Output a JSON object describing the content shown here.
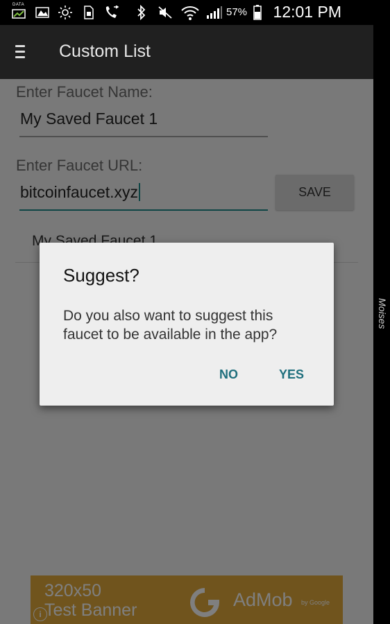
{
  "status_bar": {
    "data_label": "DATA",
    "battery_percent": "57%",
    "time": "12:01 PM"
  },
  "app_bar": {
    "title": "Custom List"
  },
  "form": {
    "name_label": "Enter Faucet Name:",
    "name_value": "My Saved Faucet 1",
    "url_label": "Enter Faucet URL:",
    "url_value": "bitcoinfaucet.xyz",
    "save_label": "SAVE"
  },
  "saved_list": [
    {
      "name": "My Saved Faucet 1"
    }
  ],
  "dialog": {
    "title": "Suggest?",
    "message": "Do you also want to suggest this faucet to be available in the app?",
    "no_label": "NO",
    "yes_label": "YES"
  },
  "ad_banner": {
    "size_text": "320x50",
    "test_text": "Test Banner",
    "brand": "AdMob",
    "by": "by Google",
    "info_glyph": "i"
  },
  "side_label": "Moises",
  "colors": {
    "accent": "#1f8a8a",
    "dialog_button": "#1f6f7d",
    "app_bar": "#202020",
    "ad_background": "#e0a83a"
  }
}
